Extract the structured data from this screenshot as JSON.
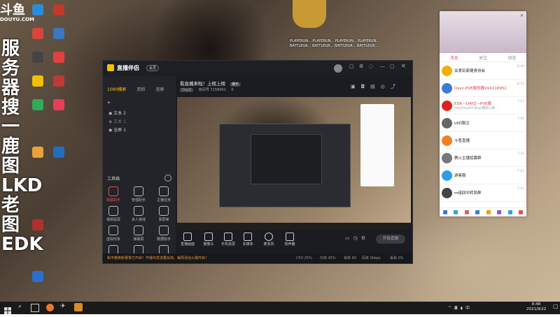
{
  "desktop": {
    "logo_main": "斗鱼",
    "logo_sub": "DOUYU.COM",
    "side_text": "服务器搜一鹿图LKD老图EDK",
    "top_files": [
      "PLAYERUN...",
      "PLAYERUN...",
      "PLAYERUN...",
      "PLAYERUN...",
      "BATTLEGR...",
      "BATTLEGR...",
      "BATTLEGR...",
      "BATTLEGR..."
    ],
    "icons": [
      {
        "label": "",
        "color": "#2e8bd6"
      },
      {
        "label": "",
        "color": "#c0392b"
      },
      {
        "label": "",
        "color": "#d9453a"
      },
      {
        "label": "",
        "color": "#3a78c2"
      },
      {
        "label": "",
        "color": "#444"
      },
      {
        "label": "",
        "color": "#e04040"
      },
      {
        "label": "",
        "color": "#f0c000"
      },
      {
        "label": "",
        "color": "#c03838"
      },
      {
        "label": "",
        "color": "#33aa55"
      },
      {
        "label": "",
        "color": "#e83e5a"
      },
      {
        "label": "",
        "color": "#e9a23b"
      },
      {
        "label": "",
        "color": "#1f6fbf"
      },
      {
        "label": "",
        "color": "#b03030"
      }
    ]
  },
  "obs": {
    "brand": "直播伴侣",
    "badge": "会员",
    "scene_tabs": [
      "1080横屏",
      "双拍",
      "竖屏"
    ],
    "scenes": [
      "文本 2",
      "文本 1",
      "全屏 1"
    ],
    "tools_title": "工具箱",
    "tools": [
      "弹幕助手",
      "管理助手",
      "主播任务",
      "视频投屏",
      "多人连线",
      "录屏等",
      "虚拟形象",
      "弹幕屏",
      "数据助手",
      "粉丝团",
      "抽奖",
      "更多"
    ],
    "stream_title": "看直播来啦！上榜上榜",
    "stream_tag": "娱乐",
    "meta": [
      "DayZ",
      "房间号",
      "7158061",
      "0"
    ],
    "bottom_items": [
      "直播画面",
      "摄像头",
      "手机投屏",
      "多媒体",
      "麦克风",
      "扬声器"
    ],
    "go_live": "开始直播",
    "notice": "和平精英新赛季已开启！开播可享流量扶持，每周活动火爆开启！",
    "status": [
      "CPU 25%",
      "内存 45%",
      "帧率 60",
      "码率 0kbps",
      "丢帧 0%"
    ]
  },
  "chat": {
    "tabs": [
      "消息",
      "关注",
      "动态"
    ],
    "items": [
      {
        "name": "关爱玩家健身协会",
        "msg": "",
        "time": "8:48",
        "color": "#f0b000"
      },
      {
        "name": "Dayz-PVE服务器VX4218952",
        "msg": "",
        "time": "8:12",
        "color": "#3b7bd6"
      },
      {
        "name": "EDK—DAYZ—PVE服",
        "msg": "Fatechoukin:Dayz模组入群...",
        "time": "7:12",
        "color": "#e02020"
      },
      {
        "name": "LKD服主",
        "msg": "",
        "time": "7:04",
        "color": "#666"
      },
      {
        "name": "斗鱼直播",
        "msg": "",
        "time": "",
        "color": "#f08020"
      },
      {
        "name": "赛火主播招募群",
        "msg": "",
        "time": "7:25",
        "color": "#777"
      },
      {
        "name": "游客服",
        "msg": "",
        "time": "7-22",
        "color": "#2c9ee8"
      },
      {
        "name": "m组回中转员群",
        "msg": "",
        "time": "7-22",
        "color": "#444"
      }
    ]
  },
  "taskbar": {
    "time": "8:48",
    "date": "2021/9/22"
  }
}
